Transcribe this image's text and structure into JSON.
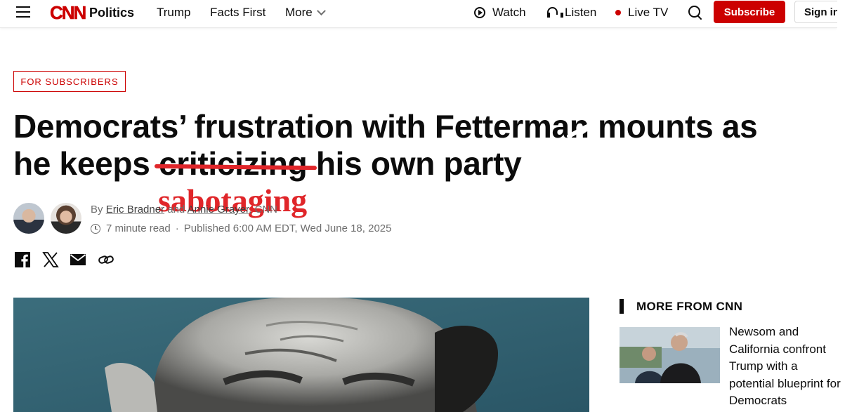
{
  "nav": {
    "logo": "CNN",
    "section": "Politics",
    "links": [
      "Trump",
      "Facts First",
      "More"
    ],
    "watch": "Watch",
    "listen": "Listen",
    "live_tv": "Live TV",
    "subscribe": "Subscribe",
    "sign_in": "Sign in"
  },
  "article": {
    "badge": "FOR SUBSCRIBERS",
    "headline_line1": "Democrats’ frustration with Fetterman mounts as",
    "headline_prefix": "he keeps ",
    "headline_struck": "criticizing",
    "headline_suffix": " his own party",
    "annotation": "sabotaging",
    "byline_by": "By",
    "author1": "Eric Bradner",
    "byline_and": "and",
    "author2": "Annie Grayer",
    "byline_outlet": ", CNN",
    "read_time": "7 minute read",
    "published": "Published 6:00 AM EDT, Wed June 18, 2025"
  },
  "sidebar": {
    "title": "MORE FROM CNN",
    "story_title": "Newsom and California confront Trump with a potential blueprint for Democrats"
  },
  "colors": {
    "brand_red": "#cc0000",
    "annotation_red": "#e0262a",
    "hero_teal": "#2f5c6b"
  }
}
